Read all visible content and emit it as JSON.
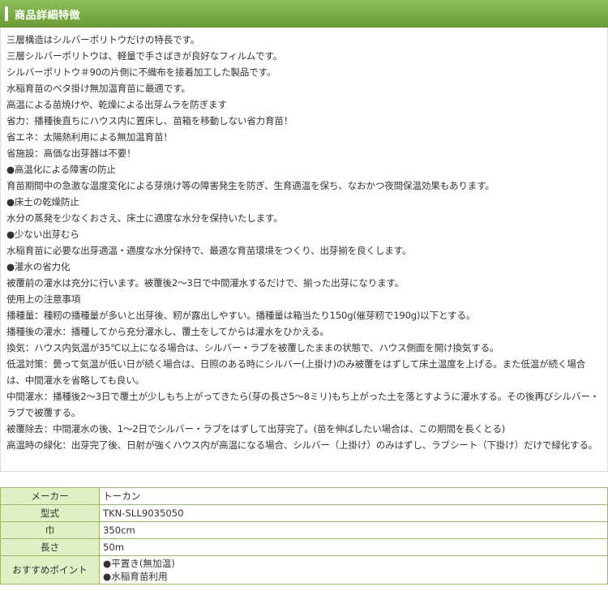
{
  "header": {
    "title": "商品詳細特徴"
  },
  "description": [
    "三層構造はシルバーポリトウだけの特長です。",
    "三層シルバーポリトウは、軽量で手さばきが良好なフィルムです。",
    "シルバーポリトウ＃90の片側に不織布を接着加工した製品です。",
    "水稲育苗のベタ掛け無加温育苗に最適です。",
    "高温による苗焼けや、乾燥による出芽ムラを防ぎます",
    "省力：播種後直ちにハウス内に置床し、苗箱を移動しない省力育苗！",
    "省エネ：太陽熱利用による無加温育苗！",
    "省施設：高価な出芽器は不要！",
    "●高温化による障害の防止",
    "育苗期間中の急激な温度変化による芽焼け等の障害発生を防ぎ、生育適温を保ち、なおかつ夜間保温効果もあります。",
    "●床土の乾燥防止",
    "水分の蒸発を少なくおさえ、床土に適度な水分を保持いたします。",
    "●少ない出芽むら",
    "水稲育苗に必要な出芽適温・適度な水分保持で、最適な育苗環境をつくり、出芽揃を良くします。",
    "●灌水の省力化",
    "被覆前の灌水は充分に行います。被覆後2〜3日で中間灌水するだけで、揃った出芽になります。",
    "使用上の注意事項",
    "播種量：種籾の播種量が多いと出芽後、籾が露出しやすい。播種量は箱当たり150g(催芽籾で190g)以下とする。",
    "播種後の灌水：播種してから充分灌水し、覆土をしてからは灌水をひかえる。",
    "換気：ハウス内気温が35℃以上になる場合は、シルバー・ラブを被覆したままの状態で、ハウス側面を開け換気する。",
    "低温対策：曇って気温が低い日が続く場合は、日照のある時にシルバー(上掛け)のみ被覆をはずして床土温度を上げる。また低温が続く場合は、中間灌水を省略しても良い。",
    "中間灌水：播種後2〜3日で覆土が少しもち上がってきたら(芽の長さ5〜8ミリ)もち上がった土を落とすように灌水する。その後再びシルバー・ラブで被覆する。",
    "被覆除去：中間灌水の後、1〜2日でシルバー・ラブをはずして出芽完了。(苗を伸ばしたい場合は、この期間を長くとる)",
    "高温時の緑化：出芽完了後、日射が強くハウス内が高温になる場合、シルバー（上掛け）のみはずし、ラブシート（下掛け）だけで緑化する。"
  ],
  "specs": [
    {
      "label": "メーカー",
      "value": "トーカン"
    },
    {
      "label": "型式",
      "value": "TKN-SLL9035050"
    },
    {
      "label": "巾",
      "value": "350cm"
    },
    {
      "label": "長さ",
      "value": "50m"
    },
    {
      "label": "おすすめポイント",
      "values": [
        "●平置き(無加温)",
        "●水稲育苗利用"
      ]
    }
  ],
  "colors": {
    "header": "#7aad45",
    "spec_label_bg": "#dff0c4",
    "border": "#9ab86c"
  }
}
